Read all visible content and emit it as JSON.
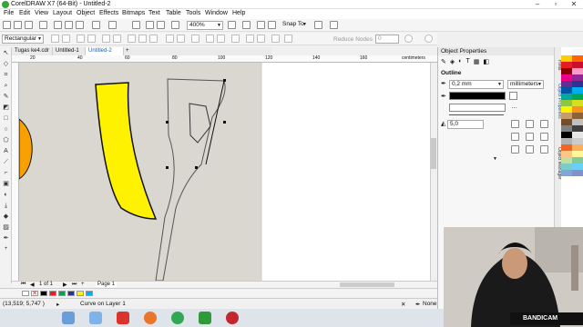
{
  "window": {
    "title": "CorelDRAW X7 (64-Bit) - Untitled-2"
  },
  "menu": [
    "File",
    "Edit",
    "View",
    "Layout",
    "Object",
    "Effects",
    "Bitmaps",
    "Text",
    "Table",
    "Tools",
    "Window",
    "Help"
  ],
  "toolbar": {
    "zoom": "400%",
    "snap_to": "Snap To"
  },
  "property_bar": {
    "selection_mode": "Rectangular",
    "reduce_nodes": "Reduce Nodes",
    "reduce_value": "0"
  },
  "doc_tabs": [
    "Tugas ke4.cdr",
    "Untitled-1",
    "Untitled-2"
  ],
  "ruler_labels": [
    "20",
    "40",
    "60",
    "80",
    "100",
    "120",
    "140",
    "160",
    "centimeters"
  ],
  "page_nav": {
    "counter": "1 of 1",
    "page_tab": "Page 1"
  },
  "status": {
    "coords": "(13,519; 5,747 )",
    "info": "Curve on Layer 1",
    "fill": "None"
  },
  "panel": {
    "title": "Object Properties",
    "section": "Outline",
    "width": "0,2 mm",
    "units": "millimeters",
    "miter": "5,0"
  },
  "docker_tabs": [
    "Hints",
    "Object Properties",
    "Object Manager"
  ],
  "watermark": "BANDICAM",
  "colors": {
    "accent": "#1a5fb4",
    "yellow_fill": "#fff200",
    "orange_fill": "#f7a000"
  },
  "palette": [
    "#ffffff",
    "#000000",
    "#e31e24",
    "#00a651",
    "#2e3192",
    "#fff200",
    "#00aeef",
    "#ec008c",
    "#808080",
    "#7b3f00"
  ],
  "side_palette": [
    "#ffffff",
    "#f7f7f7",
    "#ffcc00",
    "#ff6600",
    "#e31e24",
    "#c8102e",
    "#8b0000",
    "#ff99cc",
    "#ec008c",
    "#92278f",
    "#662d91",
    "#2e3192",
    "#0054a6",
    "#00aeef",
    "#00a99d",
    "#00a651",
    "#8dc63f",
    "#d7df23",
    "#fff200",
    "#f7941d",
    "#c69c6d",
    "#8c6239",
    "#754c24",
    "#c0c0c0",
    "#808080",
    "#404040",
    "#000000",
    "#e6e6e6",
    "#b3b3b3",
    "#cccccc",
    "#f26522",
    "#fbaf5d",
    "#fdc689",
    "#fff799",
    "#c4df9b",
    "#82ca9c",
    "#7accc8",
    "#6dcff6",
    "#7ea7d8",
    "#8393ca"
  ]
}
